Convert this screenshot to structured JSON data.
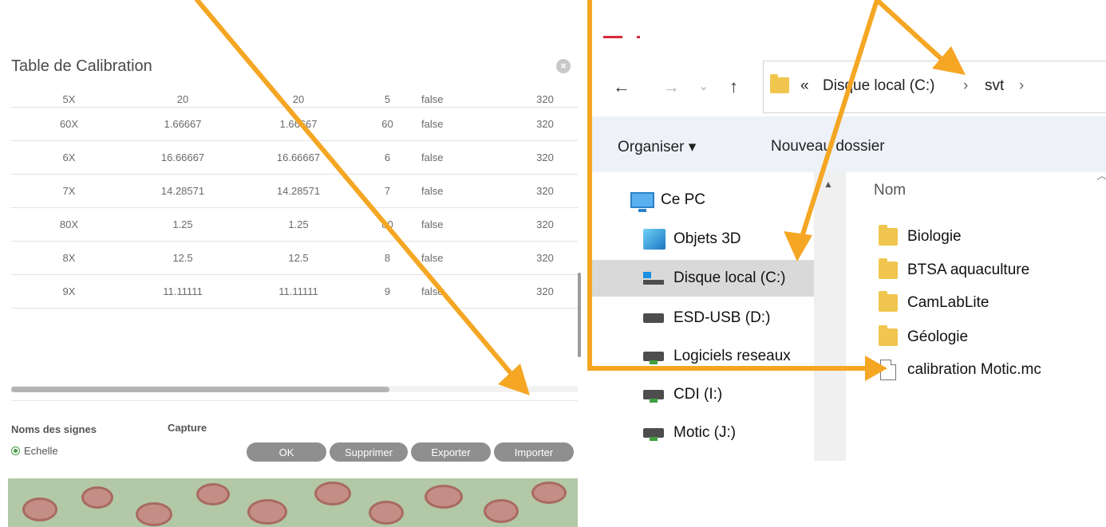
{
  "calibration": {
    "title": "Table de Calibration",
    "close_icon": "close-circle-icon",
    "rows": [
      {
        "obj": "5X",
        "x": "20",
        "y": "20",
        "mag": "5",
        "flag": "false",
        "res": "320"
      },
      {
        "obj": "60X",
        "x": "1.66667",
        "y": "1.66667",
        "mag": "60",
        "flag": "false",
        "res": "320"
      },
      {
        "obj": "6X",
        "x": "16.66667",
        "y": "16.66667",
        "mag": "6",
        "flag": "false",
        "res": "320"
      },
      {
        "obj": "7X",
        "x": "14.28571",
        "y": "14.28571",
        "mag": "7",
        "flag": "false",
        "res": "320"
      },
      {
        "obj": "80X",
        "x": "1.25",
        "y": "1.25",
        "mag": "80",
        "flag": "false",
        "res": "320"
      },
      {
        "obj": "8X",
        "x": "12.5",
        "y": "12.5",
        "mag": "8",
        "flag": "false",
        "res": "320"
      },
      {
        "obj": "9X",
        "x": "11.11111",
        "y": "11.11111",
        "mag": "9",
        "flag": "false",
        "res": "320"
      }
    ],
    "signs_label": "Noms des signes",
    "capture_label": "Capture",
    "radio_label": "Echelle",
    "buttons": {
      "ok": "OK",
      "delete": "Supprimer",
      "export": "Exporter",
      "import": "Importer"
    }
  },
  "explorer": {
    "breadcrumb": {
      "chevrons": "«",
      "drive": "Disque local (C:)",
      "sep1": "›",
      "folder": "svt",
      "sep2": "›"
    },
    "nav_icons": {
      "back": "←",
      "forward": "→",
      "recent": "⌄",
      "up": "↑"
    },
    "toolbar": {
      "organize": "Organiser ▾",
      "new_folder": "Nouveau dossier"
    },
    "nav_items": [
      "Ce PC",
      "Objets 3D",
      "Disque local (C:)",
      "ESD-USB (D:)",
      "Logiciels reseaux",
      "CDI (I:)",
      "Motic (J:)"
    ],
    "column_header": "Nom",
    "files": [
      {
        "name": "Biologie",
        "icon": "folder-icon"
      },
      {
        "name": "BTSA aquaculture",
        "icon": "folder-icon"
      },
      {
        "name": "CamLabLite",
        "icon": "folder-icon"
      },
      {
        "name": "Géologie",
        "icon": "folder-icon"
      },
      {
        "name": "calibration Motic.mc",
        "icon": "file-icon"
      }
    ]
  },
  "colors": {
    "arrow": "#f5a623",
    "accent": "#d62a3a",
    "selected": "#d9d9d9",
    "toolbar": "#eef2f8",
    "button": "#8f8f8f"
  }
}
